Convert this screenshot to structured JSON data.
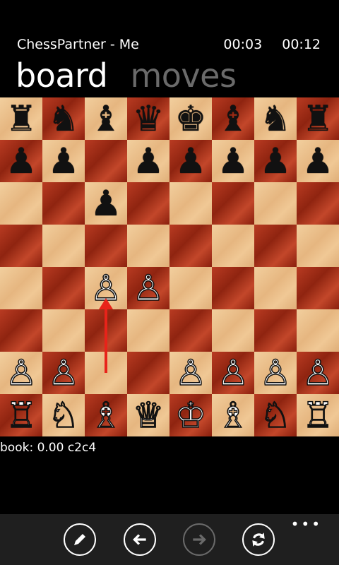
{
  "header": {
    "app_title": "ChessPartner - Me",
    "timer_white": "00:03",
    "timer_black": "00:12",
    "tabs": [
      {
        "label": "board",
        "active": true
      },
      {
        "label": "moves",
        "active": false
      }
    ]
  },
  "board": {
    "ranks": [
      [
        "♜",
        "♞",
        "♝",
        "♛",
        "♚",
        "♝",
        "♞",
        "♜"
      ],
      [
        "♟",
        "♟",
        "",
        "♟",
        "♟",
        "♟",
        "♟",
        "♟"
      ],
      [
        "",
        "",
        "♟",
        "",
        "",
        "",
        "",
        ""
      ],
      [
        "",
        "",
        "",
        "",
        "",
        "",
        "",
        ""
      ],
      [
        "",
        "",
        "♙",
        "♙",
        "",
        "",
        "",
        ""
      ],
      [
        "",
        "",
        "",
        "",
        "",
        "",
        "",
        ""
      ],
      [
        "♙",
        "♙",
        "",
        "",
        "♙",
        "♙",
        "♙",
        "♙"
      ],
      [
        "♖",
        "♘",
        "♗",
        "♕",
        "♔",
        "♗",
        "♘",
        "♖"
      ]
    ],
    "last_move": {
      "from": "c2",
      "to": "c4"
    },
    "arrow_color": "#e8231a"
  },
  "engine": {
    "status_text": "book: 0.00 c2c4"
  },
  "appbar": {
    "buttons": [
      {
        "icon": "pencil-icon",
        "enabled": true
      },
      {
        "icon": "back-arrow-icon",
        "enabled": true
      },
      {
        "icon": "forward-arrow-icon",
        "enabled": false
      },
      {
        "icon": "refresh-icon",
        "enabled": true
      }
    ],
    "more": "•••"
  }
}
